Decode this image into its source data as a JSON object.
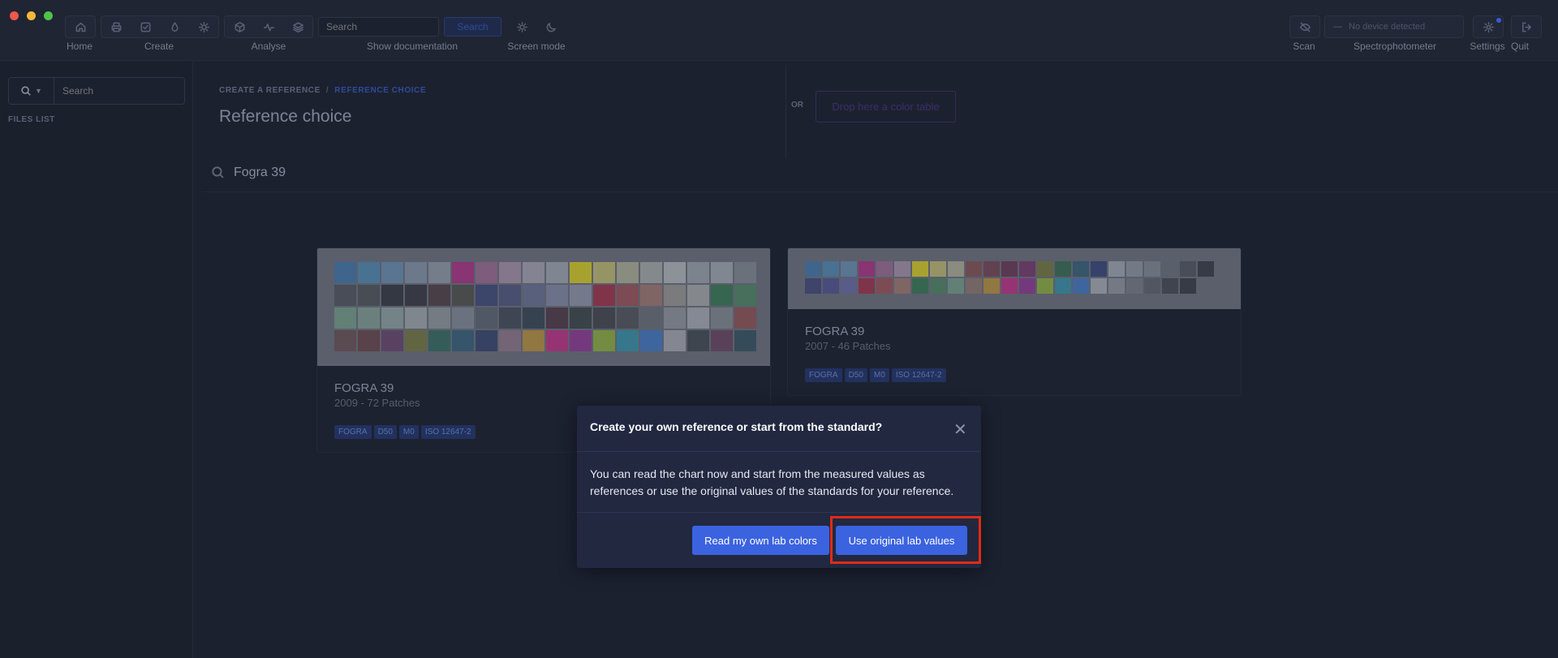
{
  "toolbar": {
    "labels": {
      "home": "Home",
      "create": "Create",
      "analyse": "Analyse",
      "show_documentation": "Show documentation",
      "screen_mode": "Screen mode",
      "scan": "Scan",
      "spectrophotometer": "Spectrophotometer",
      "settings": "Settings",
      "quit": "Quit"
    },
    "search_placeholder": "Search",
    "search_button": "Search",
    "device_status": "No device detected"
  },
  "sidebar": {
    "search_placeholder": "Search",
    "files_list_label": "FILES LIST"
  },
  "main": {
    "breadcrumb": [
      "CREATE A REFERENCE",
      "/",
      "REFERENCE CHOICE"
    ],
    "title": "Reference choice",
    "or_label": "OR",
    "drop_zone": "Drop here a color table",
    "search_value": "Fogra 39",
    "cards": [
      {
        "title": "FOGRA 39",
        "subtitle": "2009 - 72 Patches",
        "tags": [
          "FOGRA",
          "D50",
          "M0",
          "ISO 12647-2"
        ],
        "patch_colors": [
          "#2a6aa8",
          "#3a7fb3",
          "#5a86b0",
          "#7a8ea6",
          "#8c96a4",
          "#b0107a",
          "#9a5a8a",
          "#a88aa8",
          "#a8a0b0",
          "#a0a6b0",
          "#e8d800",
          "#c8c060",
          "#b0b090",
          "#a8aca8",
          "#b8bcc0",
          "#9aa0aa",
          "#a0a8b0",
          "#7a8088",
          "#3a3e48",
          "#3a3e44",
          "#141820",
          "#1a1a22",
          "#3a2228",
          "#3a3a30",
          "#24306a",
          "#3a4070",
          "#5a6088",
          "#7a80a0",
          "#8a90a8",
          "#a01030",
          "#9a3a40",
          "#a06a60",
          "#98908a",
          "#a8a8a8",
          "#1a6a3a",
          "#3a7a50",
          "#6a9a80",
          "#7a9a8a",
          "#8aa0a0",
          "#a0a6aa",
          "#8a9298",
          "#7a8290",
          "#4a5260",
          "#2a3240",
          "#1a2a38",
          "#3a1a28",
          "#1e2a2a",
          "#2a2a30",
          "#3a3e44",
          "#5a5e68",
          "#8a8e98",
          "#a8acb4",
          "#7a8088",
          "#8a3a3a",
          "#5a3a38",
          "#5a2a30",
          "#5a2a5a",
          "#6a6a20",
          "#1a5a4a",
          "#1a4a6a",
          "#1a2a5a",
          "#8a6a80",
          "#c08a20",
          "#c8107a",
          "#8a1a8a",
          "#8ab020",
          "#1a8aa8",
          "#2a6ac8",
          "#a8a8b0",
          "#2a3038",
          "#5a2a4a",
          "#1a3a4a"
        ]
      },
      {
        "title": "FOGRA 39",
        "subtitle": "2007 - 46 Patches",
        "tags": [
          "FOGRA",
          "D50",
          "M0",
          "ISO 12647-2"
        ],
        "patch_colors": [
          "#2a6aa8",
          "#3a7fb3",
          "#5a86b0",
          "#b0107a",
          "#9a5a8a",
          "#a88aa8",
          "#e8d800",
          "#c8c060",
          "#b0b090",
          "#7a3a3a",
          "#6a2a3a",
          "#5a1a3a",
          "#6a1a5a",
          "#6a6a20",
          "#1a5a3a",
          "#1a4a6a",
          "#1a2a6a",
          "#a0a6b0",
          "#8a909a",
          "#7a8088",
          "#5a6068",
          "#3a3e48",
          "#1a1e28",
          "#2a2e6a",
          "#3a3a8a",
          "#5a5aa0",
          "#a01030",
          "#9a3a40",
          "#a06a60",
          "#1a6a3a",
          "#3a7a50",
          "#6a9a80",
          "#8a6a60",
          "#c08a20",
          "#c8107a",
          "#8a1a8a",
          "#8ab020",
          "#1a8aa8",
          "#2a6ac8",
          "#a8acb4",
          "#8a8e98",
          "#6a6e78",
          "#4a4e58",
          "#2a2e38",
          "#1a1e24"
        ]
      }
    ]
  },
  "modal": {
    "title": "Create your own reference or start from the standard?",
    "body": "You can read the chart now and start from the measured values as references or use the original values of the standards for your reference.",
    "read_own_button": "Read my own lab colors",
    "use_original_button": "Use original lab values",
    "close_icon": "close-icon"
  },
  "colors": {
    "accent": "#3b63e0",
    "highlight": "#e02b15",
    "background": "#1c2130"
  }
}
